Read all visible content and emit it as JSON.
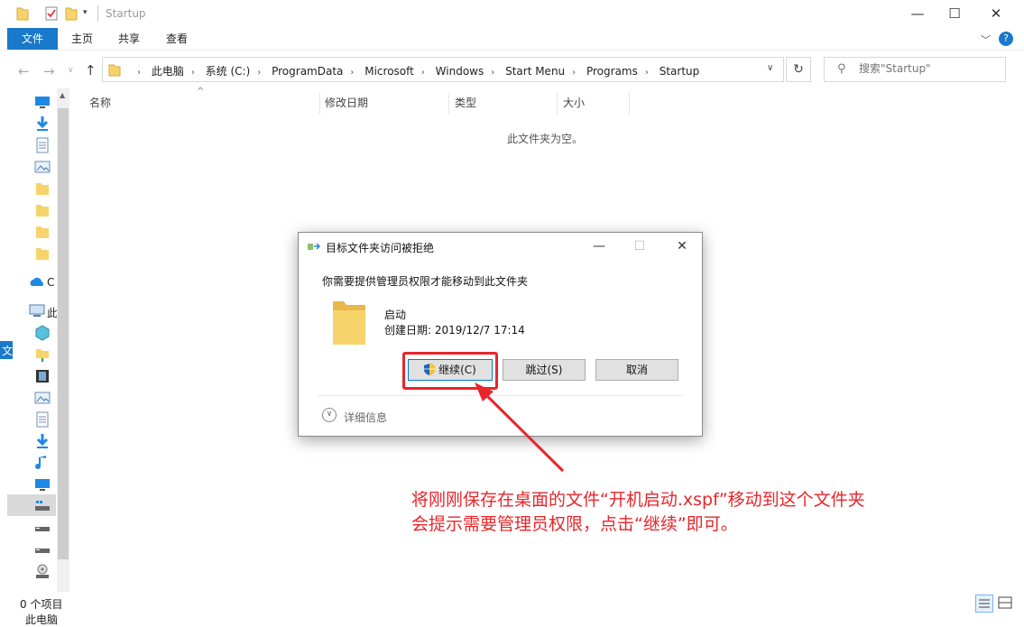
{
  "window": {
    "title": "Startup",
    "controls": {
      "minimize": "—",
      "maximize": "☐",
      "close": "✕"
    }
  },
  "ribbon": {
    "tabs": [
      "文件",
      "主页",
      "共享",
      "查看"
    ]
  },
  "address": {
    "crumbs": [
      "此电脑",
      "系统 (C:)",
      "ProgramData",
      "Microsoft",
      "Windows",
      "Start Menu",
      "Programs",
      "Startup"
    ]
  },
  "search": {
    "placeholder": "搜索\"Startup\""
  },
  "nav_pane": {
    "partial_labels": [
      "C",
      "此",
      "文"
    ]
  },
  "columns": {
    "name": "名称",
    "modified": "修改日期",
    "type": "类型",
    "size": "大小"
  },
  "content": {
    "empty_message": "此文件夹为空。"
  },
  "status": {
    "item_count": "0 个项目",
    "bottom_partial": "此电脑"
  },
  "dialog": {
    "title": "目标文件夹访问被拒绝",
    "message": "你需要提供管理员权限才能移动到此文件夹",
    "item_name": "启动",
    "item_date": "创建日期: 2019/12/7 17:14",
    "buttons": {
      "continue": "继续(C)",
      "skip": "跳过(S)",
      "cancel": "取消"
    },
    "details_label": "详细信息"
  },
  "annotation": {
    "line1": "将刚刚保存在桌面的文件“开机启动.xspf”移动到这个文件夹",
    "line2": "会提示需要管理员权限，点击“继续”即可。",
    "color": "#e8262b"
  },
  "colors": {
    "accent": "#1979ca",
    "folder": "#f7d46b"
  }
}
